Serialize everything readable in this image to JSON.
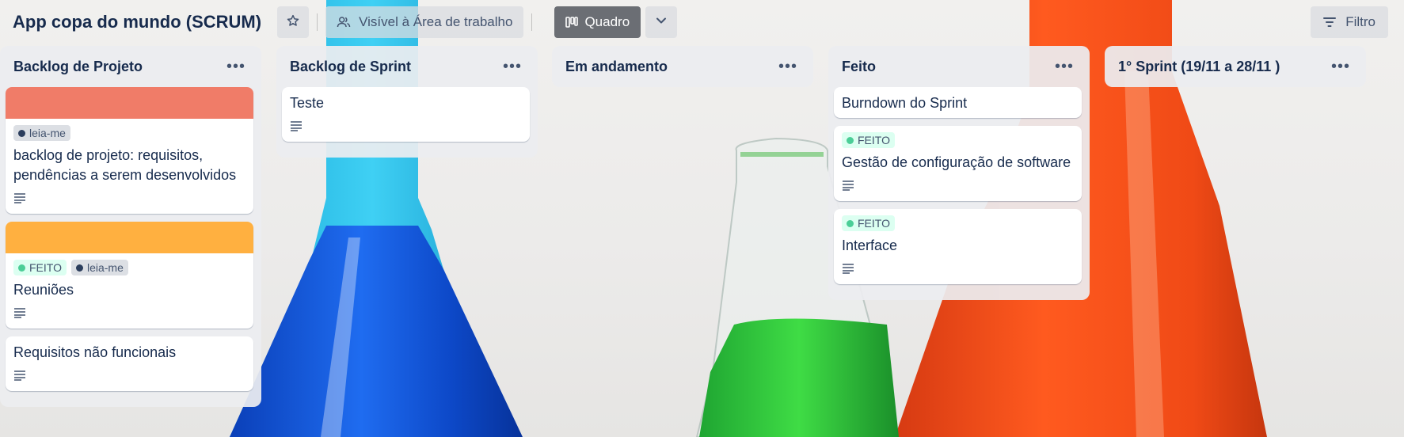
{
  "board": {
    "title": "App copa do mundo (SCRUM)",
    "visibility_label": "Visível à Área de trabalho",
    "view_label": "Quadro",
    "filter_label": "Filtro"
  },
  "colors": {
    "label_feito": "#4bce97",
    "label_feito_bg": "#dcfff1",
    "label_leia_me": "#44546f",
    "label_leia_me_bg": "#dcdfe4",
    "cover_red": "#f87462",
    "cover_orange": "#fea362"
  },
  "lists": [
    {
      "title": "Backlog de Projeto",
      "cards": [
        {
          "cover": "red",
          "labels": [
            "leia-me"
          ],
          "title": "backlog de projeto: requisitos, pendências a serem desenvolvidos",
          "has_description": true
        },
        {
          "cover": "orange",
          "labels": [
            "FEITO",
            "leia-me"
          ],
          "title": "Reuniões",
          "has_description": true
        },
        {
          "cover": null,
          "labels": [],
          "title": "Requisitos não funcionais",
          "has_description": true
        }
      ]
    },
    {
      "title": "Backlog de Sprint",
      "cards": [
        {
          "cover": null,
          "labels": [],
          "title": "Teste",
          "has_description": true
        }
      ]
    },
    {
      "title": "Em andamento",
      "cards": []
    },
    {
      "title": "Feito",
      "cards": [
        {
          "cover": null,
          "labels": [],
          "title": "Burndown do Sprint",
          "has_description": false
        },
        {
          "cover": null,
          "labels": [
            "FEITO"
          ],
          "title": "Gestão de configuração de software",
          "has_description": true
        },
        {
          "cover": null,
          "labels": [
            "FEITO"
          ],
          "title": "Interface",
          "has_description": true
        }
      ]
    },
    {
      "title": "1° Sprint (19/11 a 28/11 )",
      "cards": []
    }
  ],
  "icons": {
    "star": "star-icon",
    "visibility": "people-icon",
    "board_view": "board-columns-icon",
    "caret": "chevron-down-icon",
    "filter": "filter-icon",
    "list_menu": "more-dots-icon",
    "description": "description-icon"
  }
}
